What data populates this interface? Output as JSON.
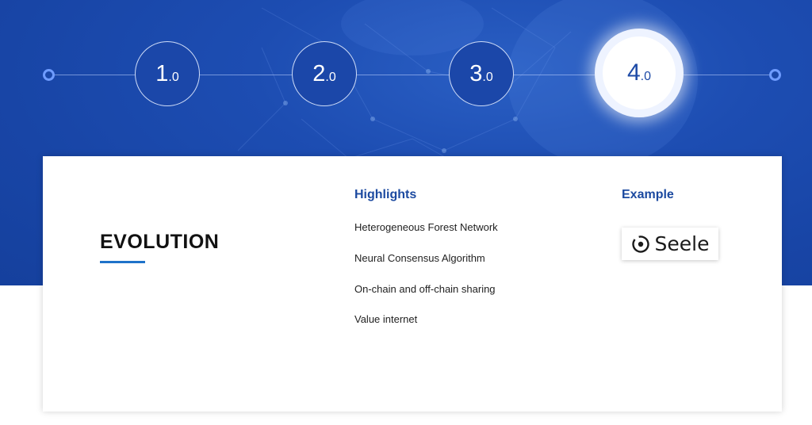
{
  "timeline": {
    "versions": [
      {
        "major": "1",
        "minor": ".0",
        "active": false
      },
      {
        "major": "2",
        "minor": ".0",
        "active": false
      },
      {
        "major": "3",
        "minor": ".0",
        "active": false
      },
      {
        "major": "4",
        "minor": ".0",
        "active": true
      }
    ]
  },
  "card": {
    "title": "EVOLUTION",
    "highlights_heading": "Highlights",
    "highlights": [
      "Heterogeneous Forest Network",
      "Neural Consensus Algorithm",
      "On-chain and off-chain sharing",
      "Value internet"
    ],
    "example_heading": "Example",
    "example_logo_text": "Seele"
  },
  "colors": {
    "hero_blue": "#1d4db2",
    "heading_blue": "#1c4aa0",
    "accent_underline": "#1f72c9"
  }
}
